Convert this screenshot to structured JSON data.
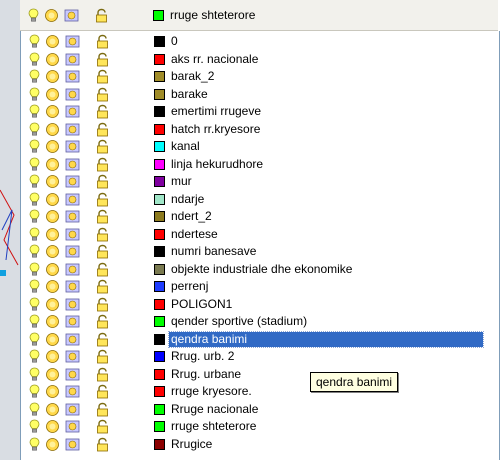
{
  "combo": {
    "current_layer": {
      "name": "rruge shteterore",
      "color": "#00ff00"
    }
  },
  "layers": [
    {
      "name": "0",
      "color": "#000000"
    },
    {
      "name": "aks rr. nacionale",
      "color": "#ff0000"
    },
    {
      "name": "barak_2",
      "color": "#a08c28"
    },
    {
      "name": "barake",
      "color": "#a08c28"
    },
    {
      "name": "emertimi rrugeve",
      "color": "#000000"
    },
    {
      "name": "hatch rr.kryesore",
      "color": "#ff0000"
    },
    {
      "name": "kanal",
      "color": "#00ffff"
    },
    {
      "name": "linja hekurudhore",
      "color": "#ff00ff"
    },
    {
      "name": "mur",
      "color": "#8000a0"
    },
    {
      "name": "ndarje",
      "color": "#a0e6c8"
    },
    {
      "name": "ndert_2",
      "color": "#8c7a1e"
    },
    {
      "name": "ndertese",
      "color": "#ff0000"
    },
    {
      "name": "numri banesave",
      "color": "#000000"
    },
    {
      "name": "objekte industriale dhe ekonomike",
      "color": "#7a7a50"
    },
    {
      "name": "perrenj",
      "color": "#1e3cff"
    },
    {
      "name": "POLIGON1",
      "color": "#ff0000"
    },
    {
      "name": "qender sportive (stadium)",
      "color": "#00ff00"
    },
    {
      "name": "qendra banimi",
      "color": "#000000",
      "selected": true
    },
    {
      "name": "Rrug. urb. 2",
      "color": "#0000ff"
    },
    {
      "name": "Rrug. urbane",
      "color": "#ff0000"
    },
    {
      "name": "rruge kryesore.",
      "color": "#ff0000"
    },
    {
      "name": "Rruge nacionale",
      "color": "#00ff00"
    },
    {
      "name": "rruge shteterore",
      "color": "#00ff00"
    },
    {
      "name": "Rrugice",
      "color": "#8b0000"
    }
  ],
  "tooltip": {
    "text": "qendra banimi"
  },
  "icons": {
    "on_off": "lightbulb-icon",
    "freeze": "sun-icon",
    "viewport_freeze": "freeze-viewport-icon",
    "lock": "padlock-icon"
  }
}
